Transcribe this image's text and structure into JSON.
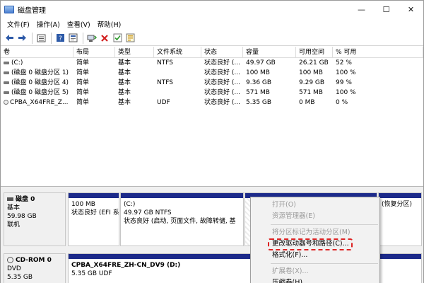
{
  "window": {
    "title": "磁盘管理",
    "minimize_label": "—",
    "maximize_label": "☐",
    "close_label": "✕"
  },
  "menu": [
    "文件(F)",
    "操作(A)",
    "查看(V)",
    "帮助(H)"
  ],
  "toolbar_icons": [
    "back-icon",
    "forward-icon",
    "list-view-icon",
    "help-icon",
    "properties-icon",
    "connect-icon",
    "delete-icon",
    "check-icon",
    "wizard-icon"
  ],
  "columns": [
    "卷",
    "布局",
    "类型",
    "文件系统",
    "状态",
    "容量",
    "可用空间",
    "% 可用"
  ],
  "volumes": [
    {
      "name": "(C:)",
      "layout": "简单",
      "type": "基本",
      "fs": "NTFS",
      "status": "状态良好 (...",
      "capacity": "49.97 GB",
      "free": "26.21 GB",
      "pct": "52 %"
    },
    {
      "name": "(磁盘 0 磁盘分区 1)",
      "layout": "简单",
      "type": "基本",
      "fs": "",
      "status": "状态良好 (...",
      "capacity": "100 MB",
      "free": "100 MB",
      "pct": "100 %"
    },
    {
      "name": "(磁盘 0 磁盘分区 4)",
      "layout": "简单",
      "type": "基本",
      "fs": "NTFS",
      "status": "状态良好 (...",
      "capacity": "9.36 GB",
      "free": "9.29 GB",
      "pct": "99 %"
    },
    {
      "name": "(磁盘 0 磁盘分区 5)",
      "layout": "简单",
      "type": "基本",
      "fs": "",
      "status": "状态良好 (...",
      "capacity": "571 MB",
      "free": "571 MB",
      "pct": "100 %"
    },
    {
      "name": "CPBA_X64FRE_Z...",
      "layout": "简单",
      "type": "基本",
      "fs": "UDF",
      "status": "状态良好 (...",
      "capacity": "5.35 GB",
      "free": "0 MB",
      "pct": "0 %"
    }
  ],
  "disks": [
    {
      "name": "磁盘 0",
      "type": "基本",
      "size": "59.98 GB",
      "state": "联机",
      "partitions": [
        {
          "line1": "",
          "line2": "100 MB",
          "line3": "状态良好 (EFI 系"
        },
        {
          "line1": "(C:)",
          "line2": "49.97 GB NTFS",
          "line3": "状态良好 (启动, 页面文件, 故障转储, 基"
        },
        {
          "line1": "",
          "line2": "",
          "line3": ""
        },
        {
          "line1": "",
          "line2": "",
          "line3": "(恢复分区)"
        }
      ]
    },
    {
      "name": "CD-ROM 0",
      "type": "DVD",
      "size": "5.35 GB",
      "partitions": [
        {
          "line1": "CPBA_X64FRE_ZH-CN_DV9  (D:)",
          "line2": "5.35 GB UDF"
        }
      ]
    }
  ],
  "context_menu": {
    "items": [
      {
        "label": "打开(O)",
        "disabled": true
      },
      {
        "label": "资源管理器(E)",
        "disabled": true
      },
      {
        "sep": true
      },
      {
        "label": "将分区标记为活动分区(M)",
        "disabled": true
      },
      {
        "label": "更改驱动器号和路径(C)...",
        "disabled": false,
        "highlighted": true
      },
      {
        "label": "格式化(F)...",
        "disabled": false
      },
      {
        "sep": true
      },
      {
        "label": "扩展卷(X)...",
        "disabled": true
      },
      {
        "label": "压缩卷(H)...",
        "disabled": false
      }
    ]
  },
  "colors": {
    "primary_partition_bar": "#1c2a8a",
    "highlight_border": "#dd2222"
  }
}
